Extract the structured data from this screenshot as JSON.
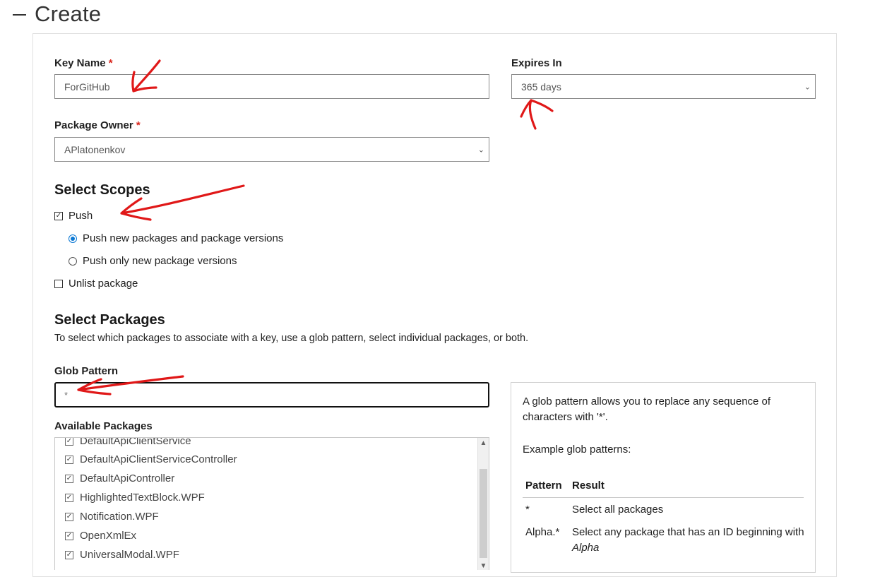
{
  "header": {
    "title": "Create"
  },
  "form": {
    "key_name": {
      "label": "Key Name",
      "required_mark": "*",
      "value": "ForGitHub"
    },
    "expires_in": {
      "label": "Expires In",
      "value": "365 days"
    },
    "package_owner": {
      "label": "Package Owner",
      "required_mark": "*",
      "value": "APlatonenkov"
    }
  },
  "scopes": {
    "heading": "Select Scopes",
    "push": {
      "label": "Push",
      "checked": true
    },
    "push_options": [
      {
        "label": "Push new packages and package versions",
        "selected": true
      },
      {
        "label": "Push only new package versions",
        "selected": false
      }
    ],
    "unlist": {
      "label": "Unlist package",
      "checked": false
    }
  },
  "packages": {
    "heading": "Select Packages",
    "description": "To select which packages to associate with a key, use a glob pattern, select individual packages, or both.",
    "glob_label": "Glob Pattern",
    "glob_value": "*",
    "available_label": "Available Packages",
    "items": [
      "DefaultApiClientService",
      "DefaultApiClientServiceController",
      "DefaultApiController",
      "HighlightedTextBlock.WPF",
      "Notification.WPF",
      "OpenXmlEx",
      "UniversalModal.WPF"
    ]
  },
  "glob_help": {
    "intro": "A glob pattern allows you to replace any sequence of characters with '*'.",
    "examples_label": "Example glob patterns:",
    "col_pattern": "Pattern",
    "col_result": "Result",
    "rows": [
      {
        "pattern": "*",
        "result": "Select all packages"
      },
      {
        "pattern": "Alpha.*",
        "result": "Select any package that has an ID beginning with",
        "result_em": "Alpha"
      }
    ]
  },
  "colors": {
    "accent": "#0a78d4",
    "required": "#d9241b",
    "annotation": "#e01818"
  }
}
